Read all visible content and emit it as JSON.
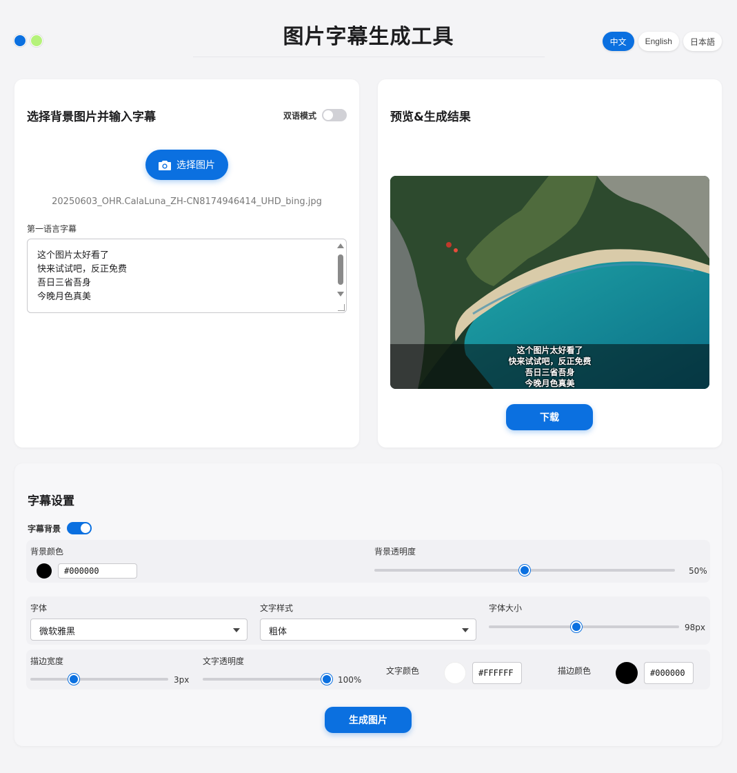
{
  "header": {
    "title": "图片字幕生成工具",
    "languages": [
      "中文",
      "English",
      "日本語"
    ],
    "active_language": "中文",
    "theme_colors": [
      "#0b70e0",
      "#b5f27a"
    ]
  },
  "input_panel": {
    "title": "选择背景图片并输入字幕",
    "bilingual_label": "双语模式",
    "bilingual_on": false,
    "choose_button": "选择图片",
    "filename": "20250603_OHR.CalaLuna_ZH-CN8174946414_UHD_bing.jpg",
    "first_lang_label": "第一语言字幕",
    "subtitle_lines": [
      "这个图片太好看了",
      "快来试试吧，反正免费",
      "吾日三省吾身",
      "今晚月色真美"
    ]
  },
  "preview_panel": {
    "title": "预览&生成结果",
    "download_button": "下载"
  },
  "settings": {
    "title": "字幕设置",
    "bg_toggle_label": "字幕背景",
    "bg_toggle_on": true,
    "bg_color_label": "背景颜色",
    "bg_color": "#000000",
    "bg_opacity_label": "背景透明度",
    "bg_opacity": 50,
    "bg_opacity_text": "50%",
    "font_label": "字体",
    "font_value": "微软雅黑",
    "style_label": "文字样式",
    "style_value": "粗体",
    "size_label": "字体大小",
    "size_value": 98,
    "size_text": "98px",
    "stroke_width_label": "描边宽度",
    "stroke_width": 3,
    "stroke_width_text": "3px",
    "text_opacity_label": "文字透明度",
    "text_opacity": 100,
    "text_opacity_text": "100%",
    "text_color_label": "文字颜色",
    "text_color": "#FFFFFF",
    "stroke_color_label": "描边颜色",
    "stroke_color": "#000000",
    "generate_button": "生成图片"
  },
  "accent_color": "#0b70e0"
}
